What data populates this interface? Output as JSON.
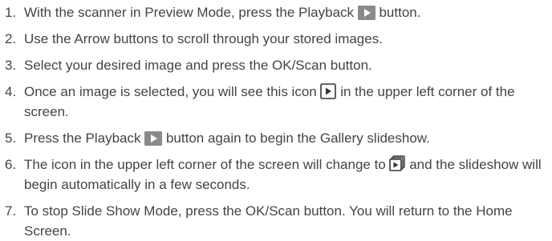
{
  "steps": [
    {
      "num": "1.",
      "parts": [
        {
          "type": "text",
          "value": "With the scanner in Preview Mode, press the Playback "
        },
        {
          "type": "icon",
          "name": "playback-button-icon"
        },
        {
          "type": "text",
          "value": " button."
        }
      ]
    },
    {
      "num": "2.",
      "parts": [
        {
          "type": "text",
          "value": "Use the Arrow buttons to scroll through your stored images."
        }
      ]
    },
    {
      "num": "3.",
      "parts": [
        {
          "type": "text",
          "value": "Select your desired image and press the OK/Scan button."
        }
      ]
    },
    {
      "num": "4.",
      "parts": [
        {
          "type": "text",
          "value": "Once an image is selected, you will see this icon "
        },
        {
          "type": "icon",
          "name": "play-frame-icon"
        },
        {
          "type": "text",
          "value": " in the upper left corner of the screen."
        }
      ]
    },
    {
      "num": "5.",
      "parts": [
        {
          "type": "text",
          "value": "Press the Playback "
        },
        {
          "type": "icon",
          "name": "playback-button-icon"
        },
        {
          "type": "text",
          "value": " button again to begin the Gallery slideshow."
        }
      ]
    },
    {
      "num": "6.",
      "parts": [
        {
          "type": "text",
          "value": "The icon in the upper left corner of the screen will change to "
        },
        {
          "type": "icon",
          "name": "slideshow-icon"
        },
        {
          "type": "text",
          "value": " and the slideshow will begin automatically in a few seconds."
        }
      ]
    },
    {
      "num": "7.",
      "parts": [
        {
          "type": "text",
          "value": "To stop Slide Show Mode, press the OK/Scan button. You will return to the Home Screen."
        }
      ]
    }
  ],
  "colors": {
    "text": "#444444",
    "icon_fill": "#8a8a8a",
    "icon_stroke": "#333333"
  }
}
